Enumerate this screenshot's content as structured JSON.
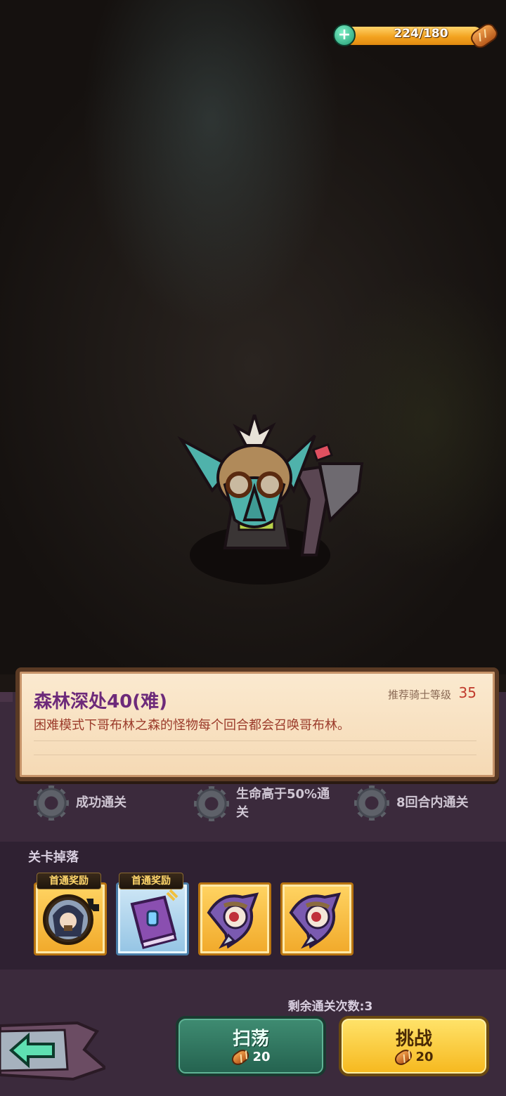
{
  "energy": {
    "current_text": "224/180",
    "fill_fraction": 1.0,
    "plus_symbol": "+"
  },
  "stage": {
    "title": "森林深处40(难)",
    "recommend_label": "推荐骑士等级",
    "recommend_level": "35",
    "description": "困难模式下哥布林之森的怪物每个回合都会召唤哥布林。"
  },
  "objectives": [
    {
      "text": "成功通关"
    },
    {
      "text": "生命高于50%通关"
    },
    {
      "text": "8回合内通关"
    }
  ],
  "drops": {
    "title": "关卡掉落",
    "first_clear_tag": "首通奖励",
    "items": [
      {
        "icon": "hero-portrait-icon",
        "first_clear": true,
        "tier": "gold"
      },
      {
        "icon": "spellbook-icon",
        "first_clear": true,
        "tier": "blue"
      },
      {
        "icon": "hooded-mage-icon",
        "first_clear": false,
        "tier": "gold"
      },
      {
        "icon": "hooded-mage-icon",
        "first_clear": false,
        "tier": "gold"
      }
    ]
  },
  "remaining": "剩余通关次数:3",
  "buttons": {
    "sweep": {
      "label": "扫荡",
      "cost": "20"
    },
    "challenge": {
      "label": "挑战",
      "cost": "20"
    }
  },
  "colors": {
    "title": "#6d2a7a",
    "desc": "#9b3a2a",
    "panel": "#3b2a3c"
  }
}
